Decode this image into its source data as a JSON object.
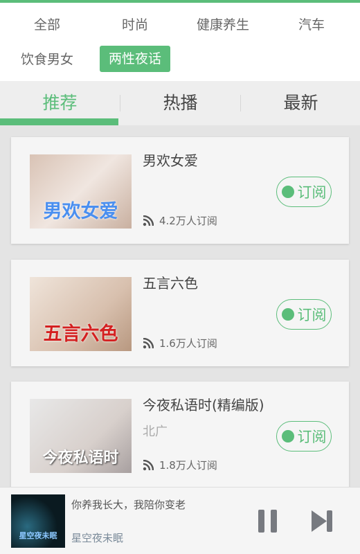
{
  "categories": [
    {
      "label": "全部",
      "active": false
    },
    {
      "label": "时尚",
      "active": false
    },
    {
      "label": "健康养生",
      "active": false
    },
    {
      "label": "汽车",
      "active": false
    },
    {
      "label": "饮食男女",
      "active": false
    },
    {
      "label": "两性夜话",
      "active": true
    }
  ],
  "tabs": [
    {
      "label": "推荐",
      "active": true
    },
    {
      "label": "热播",
      "active": false
    },
    {
      "label": "最新",
      "active": false
    }
  ],
  "accent": "#5bbd7a",
  "cards": [
    {
      "title": "男欢女爱",
      "subtitle": "",
      "count": "4.2万人订阅",
      "thumb_text": "男欢女爱",
      "button": "订阅"
    },
    {
      "title": "五言六色",
      "subtitle": "",
      "count": "1.6万人订阅",
      "thumb_text": "五言六色",
      "button": "订阅"
    },
    {
      "title": "今夜私语时(精编版)",
      "subtitle": "北广",
      "count": "1.8万人订阅",
      "thumb_text": "今夜私语时",
      "button": "订阅"
    }
  ],
  "player": {
    "title": "你养我长大，我陪你变老",
    "artist": "星空夜未眠",
    "thumb_text": "星空夜未眠"
  }
}
